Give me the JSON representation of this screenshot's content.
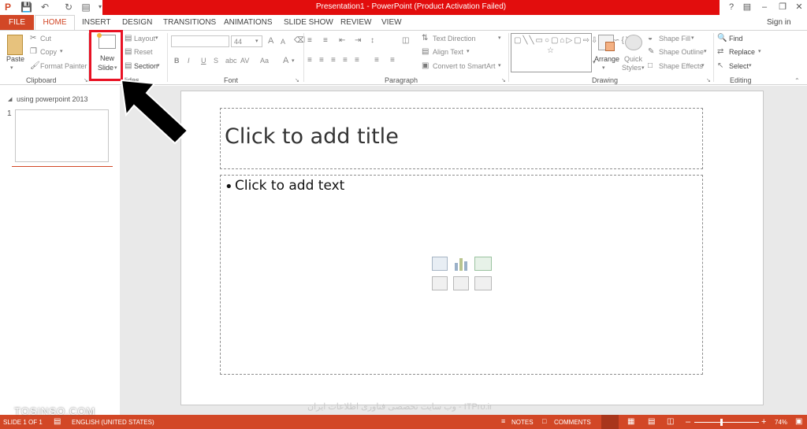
{
  "titlebar": {
    "title": "Presentation1  -  PowerPoint (Product Activation Failed)",
    "help": "?",
    "sign_in": "Sign in"
  },
  "tabs": [
    "FILE",
    "HOME",
    "INSERT",
    "DESIGN",
    "TRANSITIONS",
    "ANIMATIONS",
    "SLIDE SHOW",
    "REVIEW",
    "VIEW"
  ],
  "clipboard": {
    "paste": "Paste",
    "cut": "Cut",
    "copy": "Copy",
    "format_painter": "Format Painter",
    "label": "Clipboard"
  },
  "slides": {
    "new_slide_line1": "New",
    "new_slide_line2": "Slide",
    "layout": "Layout",
    "reset": "Reset",
    "section": "Section",
    "label": "lides"
  },
  "font": {
    "size": "44",
    "bold": "B",
    "italic": "I",
    "underline": "U",
    "strike": "S",
    "shadow": "abc",
    "spacing": "AV",
    "case": "Aa",
    "color": "A",
    "grow": "A",
    "shrink": "A",
    "label": "Font"
  },
  "paragraph": {
    "text_direction": "Text Direction",
    "align_text": "Align Text",
    "convert_smartart": "Convert to SmartArt",
    "label": "Paragraph"
  },
  "drawing": {
    "arrange": "Arrange",
    "quick_styles_1": "Quick",
    "quick_styles_2": "Styles",
    "shape_fill": "Shape Fill",
    "shape_outline": "Shape Outline",
    "shape_effects": "Shape Effects",
    "label": "Drawing"
  },
  "editing": {
    "find": "Find",
    "replace": "Replace",
    "select": "Select",
    "label": "Editing"
  },
  "left_pane": {
    "section_name": "using powerpoint 2013",
    "slide_number": "1"
  },
  "slide": {
    "title_placeholder": "Click to add title",
    "body_placeholder": "Click to add text"
  },
  "status": {
    "slide_of": "SLIDE 1 OF 1",
    "language": "ENGLISH (UNITED STATES)",
    "notes": "NOTES",
    "comments": "COMMENTS",
    "zoom": "74%"
  },
  "watermarks": {
    "left": "TOSINSO.COM",
    "center": "وب سایت تخصصی فناوری اطلاعات ایران - ITPro.ir"
  },
  "colors": {
    "accent": "#d24726",
    "titlebar_red": "#e20d0d",
    "highlight": "#e81123"
  }
}
